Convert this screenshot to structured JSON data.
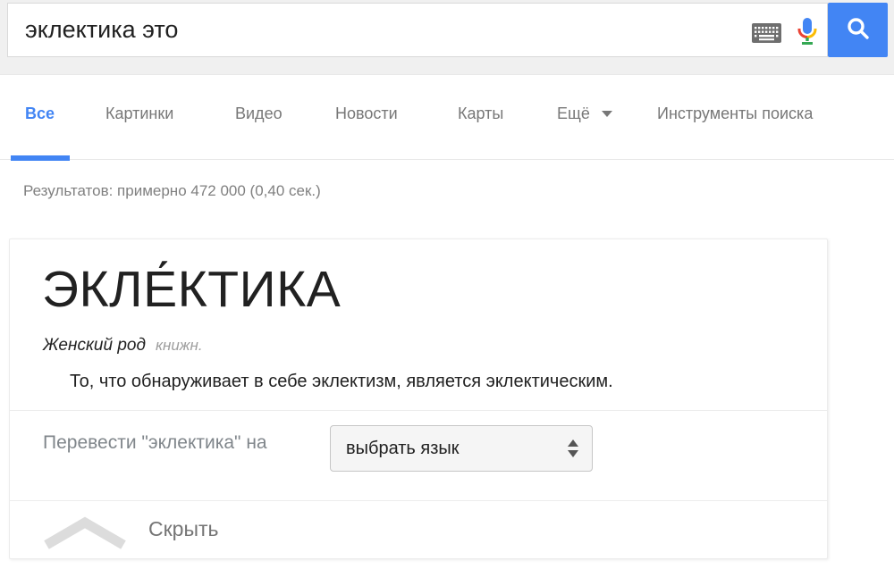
{
  "search": {
    "query": "эклектика это",
    "button_icon": "magnifier",
    "keyboard_icon": "on-screen-keyboard",
    "mic_icon": "voice-search"
  },
  "tabs": {
    "items": [
      {
        "label": "Все",
        "active": true
      },
      {
        "label": "Картинки",
        "active": false
      },
      {
        "label": "Видео",
        "active": false
      },
      {
        "label": "Новости",
        "active": false
      },
      {
        "label": "Карты",
        "active": false
      },
      {
        "label": "Ещё",
        "active": false,
        "has_dropdown": true
      },
      {
        "label": "Инструменты поиска",
        "active": false
      }
    ]
  },
  "stats": {
    "text": "Результатов: примерно 472 000 (0,40 сек.)"
  },
  "dictionary_card": {
    "word": "ЭКЛЕ́КТИКА",
    "gender": "Женский род",
    "register": "книжн.",
    "definition": "То, что обнаруживает в себе эклектизм, является эклектическим.",
    "translate_label": "Перевести \"эклектика\" на",
    "language_select": {
      "value": "выбрать язык"
    },
    "hide_label": "Скрыть"
  },
  "colors": {
    "accent_blue": "#4285f4",
    "mic_red": "#ea4335",
    "mic_yellow": "#fbbc05",
    "mic_green": "#34a853",
    "header_gray": "#f0f0f0",
    "text_dark": "#212121",
    "text_gray": "#777777"
  }
}
